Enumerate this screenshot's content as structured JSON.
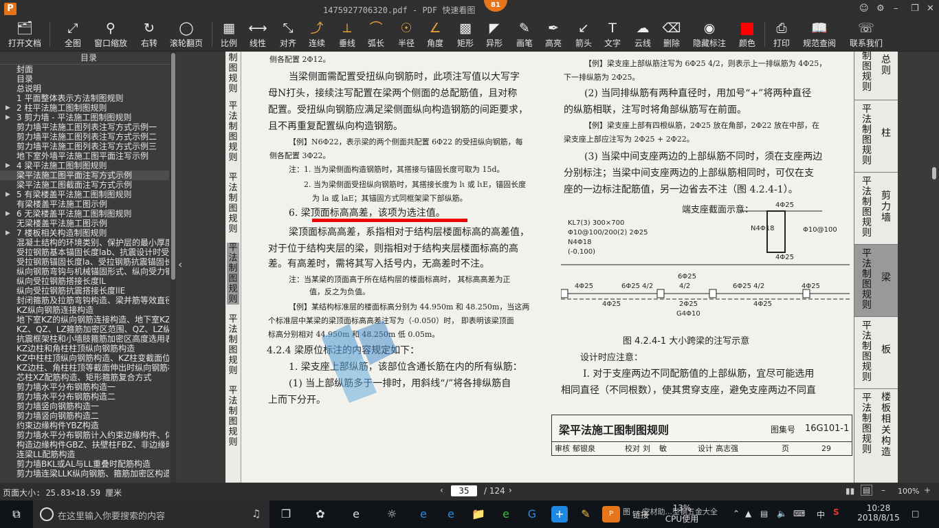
{
  "window": {
    "title": "1475927706320.pdf - PDF 快速看图 ",
    "badge": "81",
    "controls": [
      "user-icon",
      "settings-icon",
      "minimize-icon",
      "restore-icon",
      "close-icon"
    ]
  },
  "toolbar": {
    "items": [
      {
        "label": "打开文档",
        "icon": "folder-icon"
      },
      {
        "label": "全图",
        "icon": "fullscreen-icon"
      },
      {
        "label": "窗口缩放",
        "icon": "zoom-window-icon"
      },
      {
        "label": "右转",
        "icon": "rotate-icon"
      },
      {
        "label": "滚轮翻页",
        "icon": "mouse-icon"
      },
      {
        "label": "比例",
        "icon": "scale-icon"
      },
      {
        "label": "线性",
        "icon": "linear-icon"
      },
      {
        "label": "对齐",
        "icon": "align-icon"
      },
      {
        "label": "连续",
        "icon": "continuous-icon"
      },
      {
        "label": "垂线",
        "icon": "perpendicular-icon"
      },
      {
        "label": "弧长",
        "icon": "arc-length-icon"
      },
      {
        "label": "半径",
        "icon": "radius-icon"
      },
      {
        "label": "角度",
        "icon": "angle-icon"
      },
      {
        "label": "矩形",
        "icon": "rectangle-icon"
      },
      {
        "label": "异形",
        "icon": "irregular-shape-icon"
      },
      {
        "label": "画笔",
        "icon": "brush-icon"
      },
      {
        "label": "高亮",
        "icon": "highlight-icon"
      },
      {
        "label": "箭头",
        "icon": "arrow-icon"
      },
      {
        "label": "文字",
        "icon": "text-icon"
      },
      {
        "label": "云线",
        "icon": "cloud-line-icon"
      },
      {
        "label": "删除",
        "icon": "eraser-icon"
      },
      {
        "label": "隐藏标注",
        "icon": "hide-annotation-icon"
      },
      {
        "label": "颜色",
        "icon": "color-swatch-icon"
      },
      {
        "label": "打印",
        "icon": "printer-icon"
      },
      {
        "label": "规范查阅",
        "icon": "book-icon"
      },
      {
        "label": "联系我们",
        "icon": "headset-icon"
      }
    ]
  },
  "sidebar": {
    "title": "目录",
    "items": [
      {
        "label": "封面",
        "caret": false,
        "selected": false
      },
      {
        "label": "目录",
        "caret": false,
        "selected": false
      },
      {
        "label": "总说明",
        "caret": false,
        "selected": false
      },
      {
        "label": "1 平面整体表示方法制图规则",
        "caret": false,
        "selected": false
      },
      {
        "label": "2 柱平法施工图制图规则",
        "caret": true,
        "selected": false
      },
      {
        "label": "3 剪力墙 - 平法施工图制图规则",
        "caret": true,
        "selected": false
      },
      {
        "label": "剪力墙平法施工图列表注写方式示例一",
        "caret": false,
        "selected": false
      },
      {
        "label": "剪力墙平法施工图列表注写方式示例二",
        "caret": false,
        "selected": false
      },
      {
        "label": "剪力墙平法施工图列表注写方式示例三",
        "caret": false,
        "selected": false
      },
      {
        "label": "地下室外墙平法施工图平面注写示例",
        "caret": false,
        "selected": false
      },
      {
        "label": "4 梁平法施工图制图规则",
        "caret": true,
        "selected": false
      },
      {
        "label": "梁平法施工图平面注写方式示例",
        "caret": false,
        "selected": true
      },
      {
        "label": "梁平法施工图截面注写方式示例",
        "caret": false,
        "selected": false
      },
      {
        "label": "5 有梁楼盖平法施工图制图规则",
        "caret": true,
        "selected": false
      },
      {
        "label": "有梁楼盖平法施工图示例",
        "caret": false,
        "selected": false
      },
      {
        "label": "6 无梁楼盖平法施工图制图规则",
        "caret": true,
        "selected": false
      },
      {
        "label": "无梁楼盖平法施工图示例",
        "caret": false,
        "selected": false
      },
      {
        "label": "7 楼板相关构造制图规则",
        "caret": true,
        "selected": false
      },
      {
        "label": "混凝土结构的环境类别、保护层的最小厚度",
        "caret": false,
        "selected": false
      },
      {
        "label": "受拉钢筋基本锚固长度lab、抗震设计时受拉",
        "caret": false,
        "selected": false
      },
      {
        "label": "受拉钢筋锚固长度la、受拉钢筋抗震锚固长",
        "caret": false,
        "selected": false
      },
      {
        "label": "纵向钢筋弯钩与机械锚固形式、纵向受力钢",
        "caret": false,
        "selected": false
      },
      {
        "label": "纵向受拉钢筋搭接长度lL",
        "caret": false,
        "selected": false
      },
      {
        "label": "纵向受拉钢筋抗震搭接长度llE",
        "caret": false,
        "selected": false
      },
      {
        "label": "封闭箍筋及拉筋弯钩构造、梁并筋等效直径",
        "caret": false,
        "selected": false
      },
      {
        "label": "KZ纵向钢筋连接构造",
        "caret": false,
        "selected": false
      },
      {
        "label": "地下室KZ的纵向钢筋连接构造、地下室KZ的",
        "caret": false,
        "selected": false
      },
      {
        "label": "KZ、QZ、LZ箍筋加密区范围、QZ、LZ纵向钢",
        "caret": false,
        "selected": false
      },
      {
        "label": "抗震框架柱和小墙肢箍筋加密区高度选用表",
        "caret": false,
        "selected": false
      },
      {
        "label": "KZ边柱和角柱柱顶纵向钢筋构造",
        "caret": false,
        "selected": false
      },
      {
        "label": "KZ中柱柱顶纵向钢筋构造、KZ柱变截面位置",
        "caret": false,
        "selected": false
      },
      {
        "label": "KZ边柱、角柱柱顶等截面伸出时纵向钢筋构",
        "caret": false,
        "selected": false
      },
      {
        "label": "芯柱XZ配筋构造、矩形箍筋复合方式",
        "caret": false,
        "selected": false
      },
      {
        "label": "剪力墙水平分布钢筋构造一",
        "caret": false,
        "selected": false
      },
      {
        "label": "剪力墙水平分布钢筋构造二",
        "caret": false,
        "selected": false
      },
      {
        "label": "剪力墙竖向钢筋构造一",
        "caret": false,
        "selected": false
      },
      {
        "label": "剪力墙竖向钢筋构造二",
        "caret": false,
        "selected": false
      },
      {
        "label": "约束边缘构件YBZ构造",
        "caret": false,
        "selected": false
      },
      {
        "label": "剪力墙水平分布钢筋计入约束边缘构件、体",
        "caret": false,
        "selected": false
      },
      {
        "label": "构造边缘构件GBZ、扶壁柱FBZ、非边缘暗柱",
        "caret": false,
        "selected": false
      },
      {
        "label": "连梁LL配筋构造",
        "caret": false,
        "selected": false
      },
      {
        "label": "剪力墙BKL或AL与LL重叠时配筋构造",
        "caret": false,
        "selected": false
      },
      {
        "label": "剪力墙连梁LLK纵向钢筋、箍筋加密区构造",
        "caret": false,
        "selected": false
      }
    ]
  },
  "left_strip": {
    "tabs": [
      "制图规则",
      "平法制图规则",
      "平法制图规则",
      "平法制图规则",
      "平法制图规则",
      "平法制图规则"
    ]
  },
  "document": {
    "lines": [
      "侧各配置 2Φ12。",
      "当梁侧面需配置受扭纵向钢筋时，此项注写值以大写字",
      "母N打头，接续注写配置在梁两个侧面的总配筋值，且对称",
      "配置。受扭纵向钢筋应满足梁侧面纵向构造钢筋的间距要求，",
      "且不再重复配置纵向构造钢筋。",
      "【例】N6Φ22，表示梁的两个侧面共配置 6Φ22 的受扭纵向钢筋，每",
      "侧各配置 3Φ22。",
      "注：1. 当为梁侧面构造钢筋时，其搭接与锚固长度可取为 15d。",
      "2. 当为梁侧面受扭纵向钢筋时，其搭接长度为 lι 或 lιE，锚固长度",
      "为 la 或 laE；其锚固方式同框架梁下部纵筋。",
      "6. 梁顶面标高高差，该项为选注值。",
      "梁顶面标高高差，系指相对于结构层楼面标高的高差值，",
      "对于位于结构夹层的梁，则指相对于结构夹层楼面标高的高",
      "差。有高差时，需将其写入括号内，无高差时不注。",
      "注：当某梁的顶面高于所在结构层的楼面标高时， 其标高高差为正",
      "值，反之为负值。",
      "【例】某结构标准层的楼面标高分别为 44.950m 和 48.250m，当这两",
      "个标准层中某梁的梁顶面标高高差注写为（-0.050）时， 即表明该梁顶面",
      "标高分别相对 44.950m 和 48.250m 低 0.05m。",
      "4.2.4 梁原位标注的内容规定如下：",
      "1. 梁支座上部纵筋，该部位含通长筋在内的所有纵筋：",
      "(1) 当上部纵筋多于一排时，用斜线“/”将各排纵筋自",
      "上而下分开。"
    ],
    "right_lines": [
      "【例】梁支座上部纵筋注写为 6Φ25 4/2，则表示上一排纵筋为 4Φ25，",
      "下一排纵筋为 2Φ25。",
      "(2) 当同排纵筋有两种直径时，用加号“+”将两种直径",
      "的纵筋相联，注写时将角部纵筋写在前面。",
      "【例】梁支座上部有四根纵筋，2Φ25 放在角部，2Φ22 放在中部，在",
      "梁支座上部应注写为 2Φ25 + 2Φ22。",
      "(3) 当梁中间支座两边的上部纵筋不同时，须在支座两边",
      "分别标注；当梁中间支座两边的上部纵筋相同时，可仅在支",
      "座的一边标注配筋值，另一边省去不注（图 4.2.4-1）。"
    ],
    "figure": {
      "section_caption": "端支座截面示意：",
      "beam_label_1": "KL7(3)  300×700",
      "beam_label_2": "Φ10@100/200(2)  2Φ25",
      "beam_label_3": "N4Φ18",
      "beam_label_4": "(-0.100)",
      "section_top": "4Φ25",
      "section_side": "N4Φ18",
      "section_stirrup": "Φ10@100",
      "section_bottom": "4Φ25",
      "top_labels": [
        "4Φ25",
        "6Φ25 4/2",
        "6Φ25",
        "6Φ25 4/2",
        "4Φ25"
      ],
      "mid_label": "4/2",
      "bottom_labels": [
        "4Φ25",
        "2Φ25",
        "4Φ25"
      ],
      "g_label": "G4Φ10",
      "caption": "图 4.2.4-1  大小跨梁的注写示意"
    },
    "design_note_title": "设计时应注意：",
    "design_note_lines": [
      "Ⅰ. 对于支座两边不同配筋值的上部纵筋，宜尽可能选用",
      "相同直径（不同根数），使其贯穿支座，避免支座两边不同直"
    ]
  },
  "title_block": {
    "title": "梁平法施工图制图规则",
    "label": "图集号",
    "code": "16G101-1",
    "row": [
      "审核",
      "郁银泉",
      "校对",
      "刘",
      "敏",
      "设计",
      "高志强",
      "页",
      "29"
    ]
  },
  "right_strip": {
    "tabs": [
      {
        "v": "制图规则",
        "s": "总则"
      },
      {
        "v": "平法制图规则",
        "s": "柱"
      },
      {
        "v": "平法制图规则",
        "s": "剪力墙"
      },
      {
        "v": "平法制图规则",
        "s": "梁"
      },
      {
        "v": "平法制图规则",
        "s": "板"
      },
      {
        "v": "平法制图规则",
        "s": "楼板相关构造"
      }
    ]
  },
  "statusbar": {
    "page_size": "页面大小: 25.83×18.59 厘米",
    "current_page": "35",
    "total_pages": "/ 124",
    "zoom": "100%"
  },
  "taskbar": {
    "search_placeholder": "在这里输入你要搜索的内容",
    "cpu_percent": "13%",
    "cpu_label": "CPU使用",
    "link_label": "链接",
    "ime": "中",
    "time": "10:28",
    "date": "2018/8/15",
    "task_text": "图 ... 空材助...型钢五金大全"
  },
  "colors": {
    "accent": "#e5761b",
    "annotation_red": "#e00000",
    "toolbar_bg": "#303030"
  }
}
